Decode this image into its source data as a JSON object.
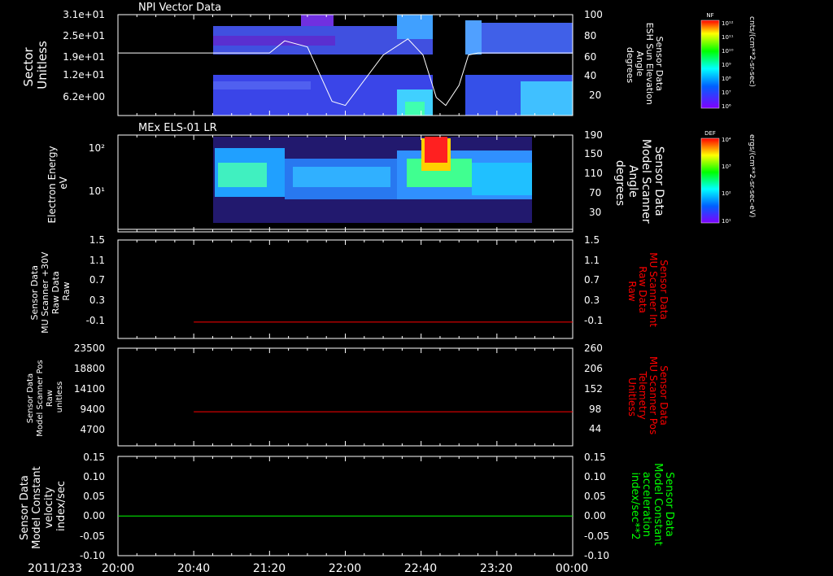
{
  "colors": {
    "background": "#000000",
    "axis": "#ffffff",
    "trace_white": "#ffffff",
    "trace_red": "#ff0000",
    "trace_green": "#00ff00"
  },
  "x_axis": {
    "date_label": "2011/233",
    "ticks": [
      "20:00",
      "20:40",
      "21:20",
      "22:00",
      "22:40",
      "23:20",
      "00:00"
    ]
  },
  "colorbars": [
    {
      "title": "NF",
      "labels": [
        "10¹²",
        "10¹¹",
        "10¹⁰",
        "10⁹",
        "10⁸",
        "10⁷",
        "10⁶"
      ],
      "units": "cnts/(cm**2-sr-sec)"
    },
    {
      "title": "DEF",
      "labels": [
        "10⁴",
        "10³",
        "10²",
        "10¹"
      ],
      "units": "ergs/(cm**2-sr-sec-eV)"
    }
  ],
  "chart_data": [
    {
      "type": "heatmap",
      "title": "NPI Vector Data",
      "ylabel": [
        "Sector",
        "Unitless"
      ],
      "y_ticks": [
        "3.1e+01",
        "2.5e+01",
        "1.9e+01",
        "1.2e+01",
        "6.2e+00"
      ],
      "y2label": [
        "Sensor Data",
        "ESH Sun Elevation",
        "Angle",
        "degrees"
      ],
      "y2_ticks": [
        "100",
        "80",
        "60",
        "40",
        "20"
      ],
      "ylim2": [
        0,
        100
      ],
      "data_start": "20:45",
      "data_end": "23:59",
      "gap": [
        "22:48",
        "22:56"
      ],
      "overlay": {
        "name": "ESH Sun Elevation Angle",
        "color": "#ffffff",
        "x": [
          "20:00",
          "21:00",
          "21:20",
          "21:28",
          "21:40",
          "21:53",
          "22:00",
          "22:20",
          "22:33",
          "22:41",
          "22:48",
          "22:53",
          "23:00",
          "23:05",
          "23:10",
          "00:00"
        ],
        "y": [
          62,
          62,
          62,
          74,
          68,
          14,
          10,
          60,
          76,
          60,
          18,
          10,
          30,
          60,
          62,
          62
        ]
      }
    },
    {
      "type": "heatmap",
      "title": "MEx ELS-01 LR",
      "ylabel": [
        "Electron Energy",
        "eV"
      ],
      "y_ticks": [
        "10²",
        "10¹"
      ],
      "y2label": [
        "Sensor Data",
        "Model Scanner",
        "Angle",
        "degrees"
      ],
      "y2_ticks": [
        "190",
        "150",
        "110",
        "70",
        "30"
      ],
      "ylim2": [
        0,
        190
      ],
      "data_start": "20:45",
      "data_end": "23:25",
      "overlay": {
        "name": "Model Scanner Angle",
        "color": "#ffffff",
        "x": [
          "20:00",
          "00:00"
        ],
        "y": [
          5,
          5
        ]
      }
    },
    {
      "type": "line",
      "ylabel": [
        "Sensor Data",
        "MU Scanner +30V",
        "Raw Data",
        "Raw"
      ],
      "y_ticks": [
        "1.5",
        "1.1",
        "0.7",
        "0.3",
        "-0.1"
      ],
      "y2label": [
        "Sensor Data",
        "MU Scanner Int",
        "Raw Data",
        "Raw"
      ],
      "y2_ticks": [
        "1.5",
        "1.1",
        "0.7",
        "0.3",
        "-0.1"
      ],
      "ylim": [
        -0.3,
        1.5
      ],
      "series": [
        {
          "name": "MU Scanner Int Raw Data",
          "color": "#ff0000",
          "x": [
            "20:40",
            "00:00"
          ],
          "y": [
            0,
            0
          ]
        }
      ]
    },
    {
      "type": "line",
      "ylabel": [
        "Sensor Data",
        "Model Scanner Pos",
        "Raw",
        "unitless"
      ],
      "y_ticks": [
        "23500",
        "18800",
        "14100",
        "9400",
        "4700"
      ],
      "y2label": [
        "Sensor Data",
        "MU Scanner Pos",
        "Telemetry",
        "Unitless"
      ],
      "y2_ticks": [
        "260",
        "206",
        "152",
        "98",
        "44"
      ],
      "ylim": [
        0,
        23500
      ],
      "series": [
        {
          "name": "MU Scanner Pos Telemetry",
          "color": "#ff0000",
          "x": [
            "20:40",
            "00:00"
          ],
          "y": [
            8200,
            8200
          ]
        }
      ]
    },
    {
      "type": "line",
      "ylabel": [
        "Sensor Data",
        "Model Constant",
        "velocity",
        "index/sec"
      ],
      "y_ticks": [
        "0.15",
        "0.10",
        "0.05",
        "0.00",
        "-0.05",
        "-0.10"
      ],
      "y2label": [
        "Sensor Data",
        "Model Constant",
        "acceleration",
        "index/sec**2"
      ],
      "y2_ticks": [
        "0.15",
        "0.10",
        "0.05",
        "0.00",
        "-0.05",
        "-0.10"
      ],
      "ylim": [
        -0.1,
        0.15
      ],
      "series": [
        {
          "name": "Model Constant acceleration",
          "color": "#00ff00",
          "x": [
            "20:00",
            "00:00"
          ],
          "y": [
            0,
            0
          ]
        }
      ]
    }
  ]
}
